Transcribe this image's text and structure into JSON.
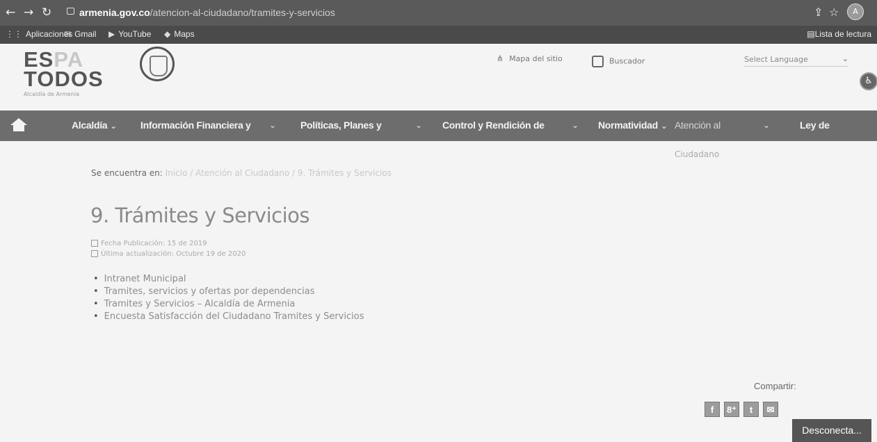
{
  "browser": {
    "url_domain": "armenia.gov.co",
    "url_path": "/atencion-al-ciudadano/tramites-y-servicios",
    "profile_initial": "A",
    "bookmarks": [
      "Aplicaciones",
      "Gmail",
      "YouTube",
      "Maps"
    ],
    "reading_list": "Lista de lectura"
  },
  "header": {
    "logo_line1_a": "ES",
    "logo_line1_b": "PA",
    "logo_line2": "TODOS",
    "logo_tagline": "Alcaldía de Armenia",
    "sitemap_label": "Mapa del sitio",
    "search_label": "Buscador",
    "language_label": "Select Language"
  },
  "nav": {
    "items": [
      "Alcaldía",
      "Información Financiera y",
      "Políticas, Planes y",
      "Control y Rendición de",
      "Normatividad",
      "Atención al",
      "Ley de"
    ],
    "subline": "Ciudadano"
  },
  "content": {
    "breadcrumb_prefix": "Se encuentra en:",
    "breadcrumb_path": "Inicio / Atención al Ciudadano / 9. Trámites y Servicios",
    "title": "9. Trámites y Servicios",
    "published": "Fecha Publicación: 15 de 2019",
    "updated": "Última actualización: Octubre 19 de 2020",
    "links": [
      "Intranet Municipal",
      "Tramites, servicios y ofertas por dependencias",
      "Tramites y Servicios – Alcaldía de Armenia",
      "Encuesta Satisfacción del Ciudadano Tramites y Servicios"
    ]
  },
  "share": {
    "label": "Compartir:",
    "buttons": [
      "f",
      "8⁺",
      "t",
      "✉"
    ]
  },
  "disconnect_label": "Desconecta..."
}
